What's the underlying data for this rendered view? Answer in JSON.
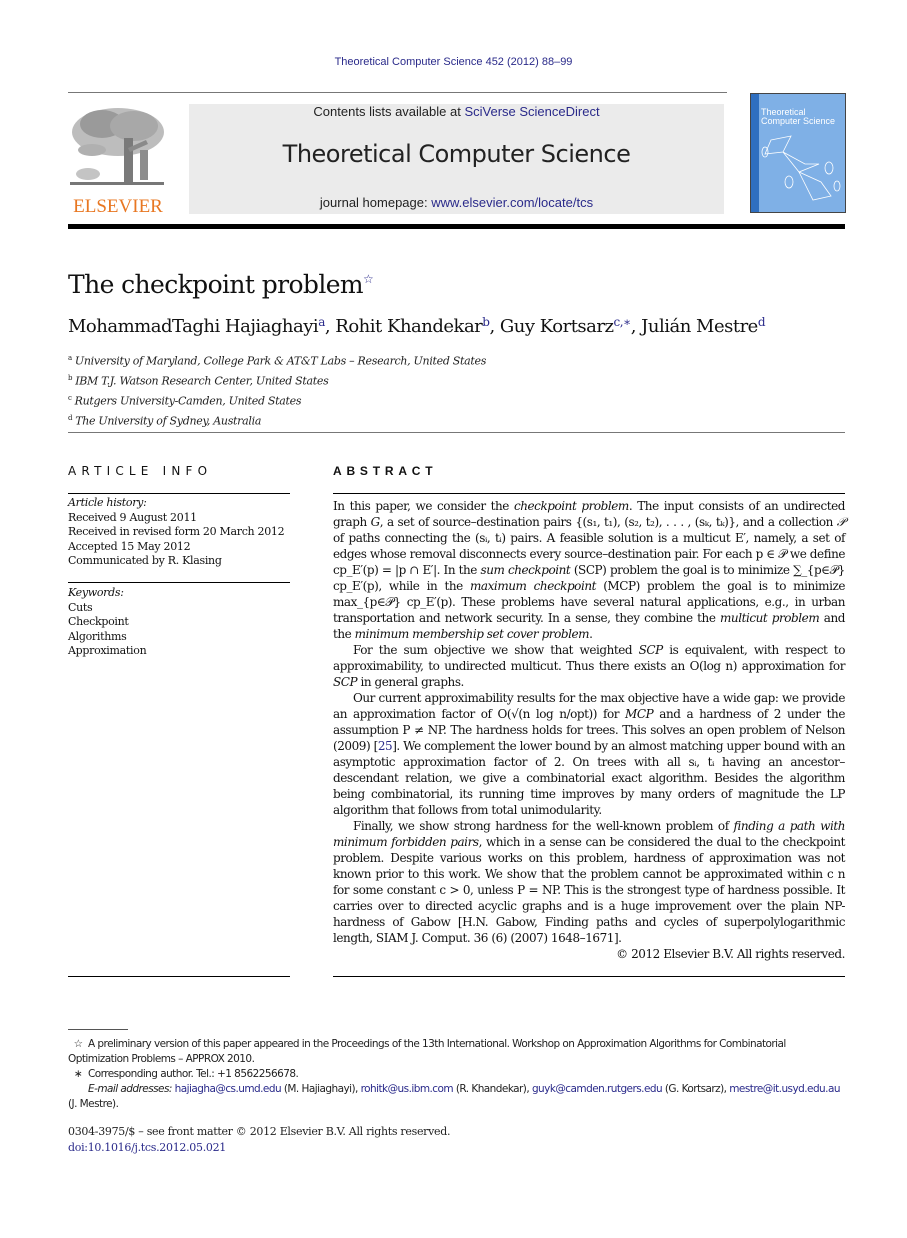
{
  "journal_reference": "Theoretical Computer Science 452 (2012) 88–99",
  "header": {
    "publisher_logo_text": "ELSEVIER",
    "contents_prefix": "Contents lists available at ",
    "contents_link": "SciVerse ScienceDirect",
    "journal_title": "Theoretical Computer Science",
    "homepage_prefix": "journal homepage: ",
    "homepage_link": "www.elsevier.com/locate/tcs",
    "cover_title_line1": "Theoretical",
    "cover_title_line2": "Computer Science"
  },
  "article": {
    "title": "The checkpoint problem",
    "title_note_mark": "☆",
    "authors": [
      {
        "name": "MohammadTaghi Hajiaghayi",
        "affil": "a"
      },
      {
        "name": "Rohit Khandekar",
        "affil": "b"
      },
      {
        "name": "Guy Kortsarz",
        "affil": "c,∗"
      },
      {
        "name": "Julián Mestre",
        "affil": "d"
      }
    ],
    "affiliations": [
      {
        "mark": "a",
        "text": "University of Maryland, College Park & AT&T Labs – Research, United States"
      },
      {
        "mark": "b",
        "text": "IBM T.J. Watson Research Center, United States"
      },
      {
        "mark": "c",
        "text": "Rutgers University-Camden, United States"
      },
      {
        "mark": "d",
        "text": "The University of Sydney, Australia"
      }
    ]
  },
  "article_info": {
    "heading": "ARTICLE INFO",
    "history_label": "Article history:",
    "history": [
      "Received 9 August 2011",
      "Received in revised form 20 March 2012",
      "Accepted 15 May 2012",
      "Communicated by R. Klasing"
    ],
    "keywords_label": "Keywords:",
    "keywords": [
      "Cuts",
      "Checkpoint",
      "Algorithms",
      "Approximation"
    ]
  },
  "abstract": {
    "heading": "ABSTRACT",
    "p1": {
      "a": "In this paper, we consider the ",
      "b_italic": "checkpoint problem",
      "c": ". The input consists of an undirected graph ",
      "d_italic": "G",
      "e": ", a set of source–destination pairs {(s₁, t₁), (s₂, t₂), . . . , (sₖ, tₖ)}, and a collection ",
      "f_italic": "𝒫",
      "g": " of paths connecting the (sᵢ, tᵢ) pairs. A feasible solution is a multicut E′, namely, a set of edges whose removal disconnects every source–destination pair. For each p ∈ 𝒫 we define cp_E′(p) = |p ∩ E′|. In the ",
      "h_italic": "sum checkpoint",
      "i": " (SCP) problem the goal is to minimize ∑_{p∈𝒫} cp_E′(p), while in the ",
      "j_italic": "maximum checkpoint",
      "k": " (MCP) problem the goal is to minimize max_{p∈𝒫} cp_E′(p). These problems have several natural applications, e.g., in urban transportation and network security. In a sense, they combine the ",
      "l_italic": "multicut problem",
      "m": " and the ",
      "n_italic": "minimum membership set cover problem",
      "o": "."
    },
    "p2": {
      "a": "For the sum objective we show that weighted ",
      "b_italic": "SCP",
      "c": " is equivalent, with respect to approximability, to undirected multicut. Thus there exists an O(log n) approximation for ",
      "d_italic": "SCP",
      "e": " in general graphs."
    },
    "p3": {
      "a": "Our current approximability results for the max objective have a wide gap: we provide an approximation factor of O(√(n log n/opt)) for ",
      "b_italic": "MCP",
      "c": " and a hardness of 2 under the assumption P ≠ NP. The hardness holds for trees. This solves an open problem of Nelson (2009) [",
      "ref": "25",
      "d": "]. We complement the lower bound by an almost matching upper bound with an asymptotic approximation factor of 2. On trees with all sᵢ, tᵢ having an ancestor–descendant relation, we give a combinatorial exact algorithm. Besides the algorithm being combinatorial, its running time improves by many orders of magnitude the LP algorithm that follows from total unimodularity."
    },
    "p4": {
      "a": "Finally, we show strong hardness for the well-known problem of ",
      "b_italic": "finding a path with minimum forbidden pairs",
      "c": ", which in a sense can be considered the dual to the checkpoint problem. Despite various works on this problem, hardness of approximation was not known prior to this work. We show that the problem cannot be approximated within c n for some constant c > 0, unless P = NP. This is the strongest type of hardness possible. It carries over to directed acyclic graphs and is a huge improvement over the plain NP-hardness of Gabow [H.N. Gabow, Finding paths and cycles of superpolylogarithmic length, SIAM J. Comput. 36 (6) (2007) 1648–1671]."
    },
    "copyright": "© 2012 Elsevier B.V. All rights reserved."
  },
  "footnotes": {
    "star_mark": "☆",
    "star_text": "A preliminary version of this paper appeared in the Proceedings of the 13th International. Workshop on Approximation Algorithms for Combinatorial Optimization Problems – APPROX 2010.",
    "corr_mark": "∗",
    "corr_text": "Corresponding author. Tel.: +1 8562256678.",
    "email_label": "E-mail addresses:",
    "emails": [
      {
        "address": "hajiagha@cs.umd.edu",
        "who": " (M. Hajiaghayi), "
      },
      {
        "address": "rohitk@us.ibm.com",
        "who": " (R. Khandekar), "
      },
      {
        "address": "guyk@camden.rutgers.edu",
        "who": " (G. Kortsarz), "
      },
      {
        "address": "mestre@it.usyd.edu.au",
        "who": " (J. Mestre)."
      }
    ]
  },
  "front_matter": {
    "issn_line": "0304-3975/$ – see front matter © 2012 Elsevier B.V. All rights reserved.",
    "doi": "doi:10.1016/j.tcs.2012.05.021"
  },
  "colors": {
    "link": "#2a2a8a",
    "elsevier_orange": "#e87722",
    "banner_bg": "#ebebeb",
    "cover_blue": "#7fb0e6"
  }
}
